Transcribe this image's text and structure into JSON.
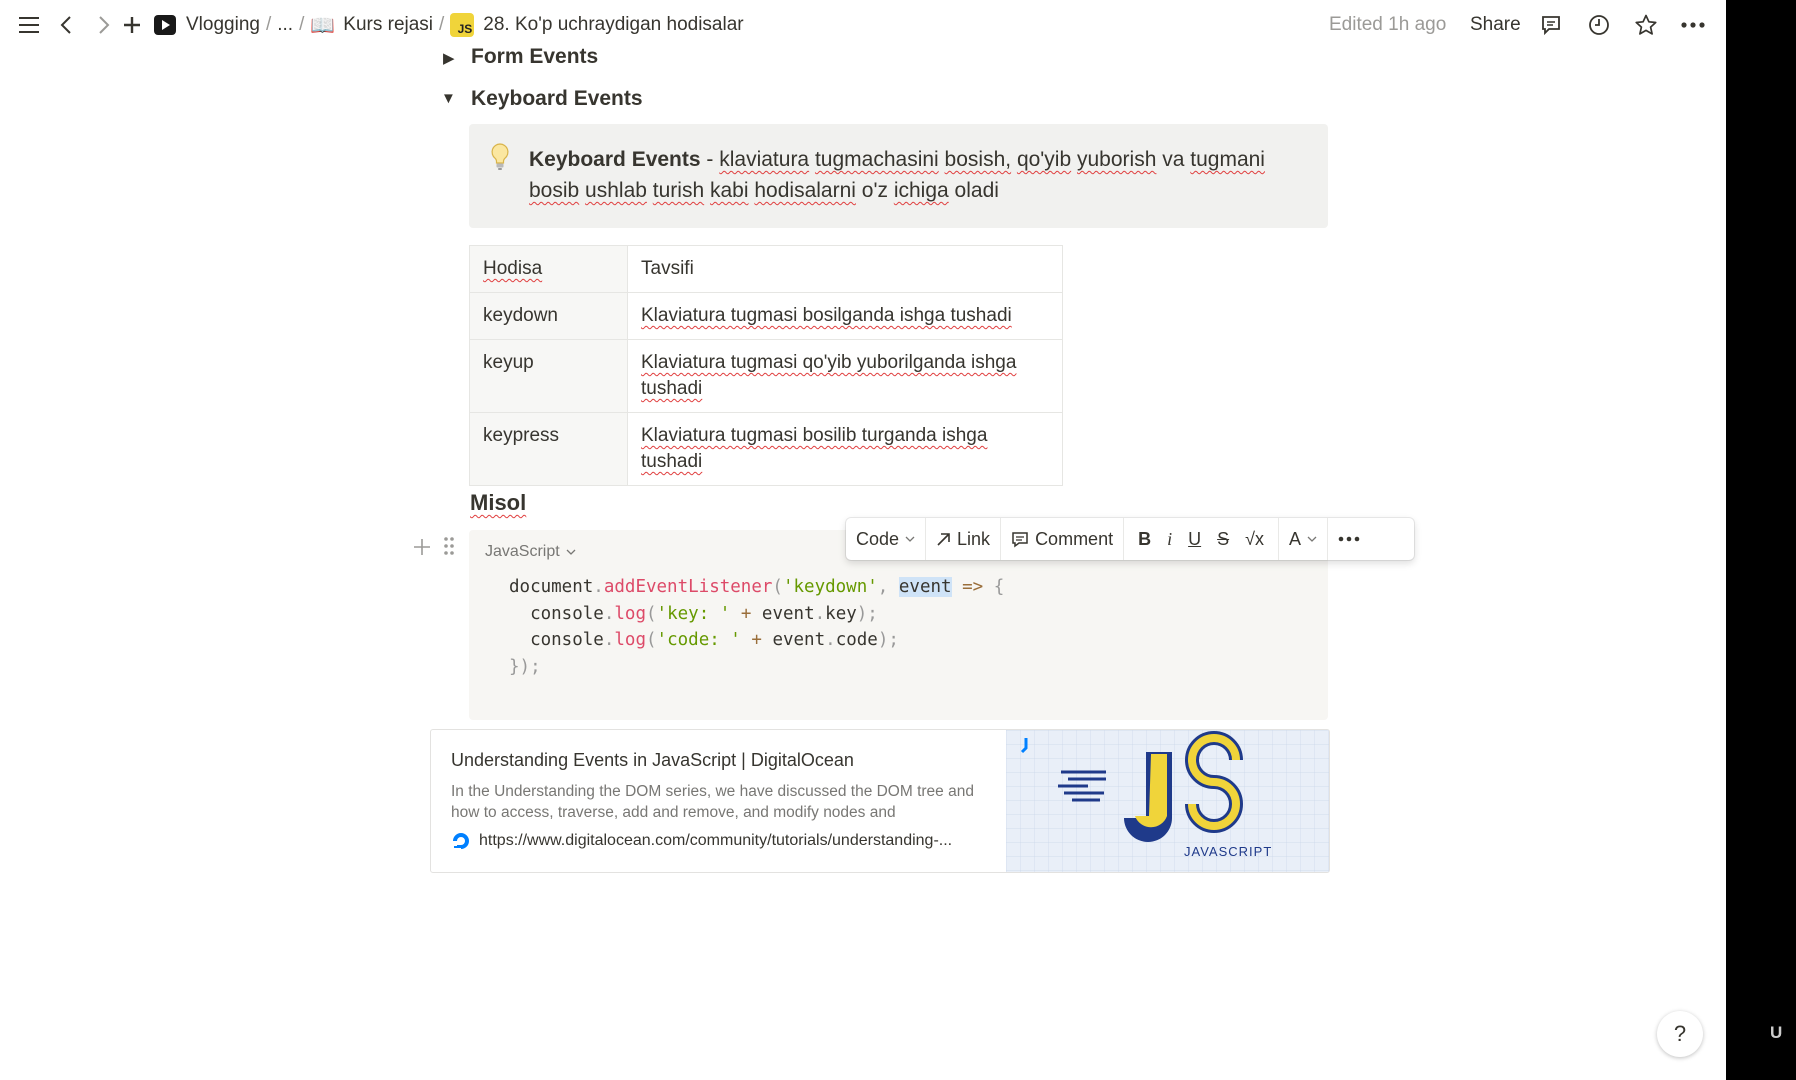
{
  "breadcrumb": {
    "items": [
      "Vlogging",
      "...",
      "Kurs rejasi",
      "28. Ko'p uchraydigan hodisalar"
    ],
    "separator": "/"
  },
  "header": {
    "edited": "Edited 1h ago",
    "share": "Share"
  },
  "content": {
    "toggle_form": "Form Events",
    "toggle_keyboard": "Keyboard Events",
    "callout": {
      "bold": "Keyboard Events",
      "dash": " - ",
      "w1": "klaviatura",
      "w2": "tugmachasini",
      "w3": "bosish,",
      "w4": "qo'yib",
      "w5": "yuborish",
      "w6": "va",
      "w7": "tugmani",
      "w8": "bosib",
      "w9": "ushlab",
      "w10": "turish",
      "w11": "kabi",
      "w12": "hodisalarni",
      "w13": "o'z",
      "w14": "ichiga",
      "w15": "oladi"
    },
    "table": {
      "headers": [
        "Hodisa",
        "Tavsifi"
      ],
      "rows": [
        [
          "keydown",
          "Klaviatura tugmasi bosilganda ishga tushadi"
        ],
        [
          "keyup",
          "Klaviatura tugmasi qo'yib yuborilganda ishga tushadi"
        ],
        [
          "keypress",
          "Klaviatura tugmasi bosilib turganda ishga tushadi"
        ]
      ]
    },
    "misol": "Misol",
    "code": {
      "language": "JavaScript",
      "l1": {
        "obj": "document",
        "dot": ".",
        "fn": "addEventListener",
        "p1": "(",
        "str": "'keydown'",
        "comma": ", ",
        "arg": "event",
        "arrow": " => ",
        "brace": "{"
      },
      "l2": {
        "indent": "  ",
        "obj": "console",
        "dot": ".",
        "fn": "log",
        "p1": "(",
        "str": "'key: '",
        "plus": " + ",
        "ref": "event",
        "dot2": ".",
        "prop": "key",
        "end": ");"
      },
      "l3": {
        "indent": "  ",
        "obj": "console",
        "dot": ".",
        "fn": "log",
        "p1": "(",
        "str": "'code: '",
        "plus": " + ",
        "ref": "event",
        "dot2": ".",
        "prop": "code",
        "end": ");"
      },
      "l4": "});"
    },
    "bookmark": {
      "title": "Understanding Events in JavaScript | DigitalOcean",
      "description": "In the Understanding the DOM series, we have discussed the DOM tree and how to access, traverse, add and remove, and modify nodes and",
      "url": "https://www.digitalocean.com/community/tutorials/understanding-...",
      "image_text": "JAVASCRIPT"
    }
  },
  "format_toolbar": {
    "code": "Code",
    "link": "Link",
    "comment": "Comment",
    "bold": "B",
    "italic": "i",
    "underline": "U",
    "strike": "S",
    "equation": "√x",
    "color": "A"
  },
  "help": "?",
  "right_logo": "U"
}
